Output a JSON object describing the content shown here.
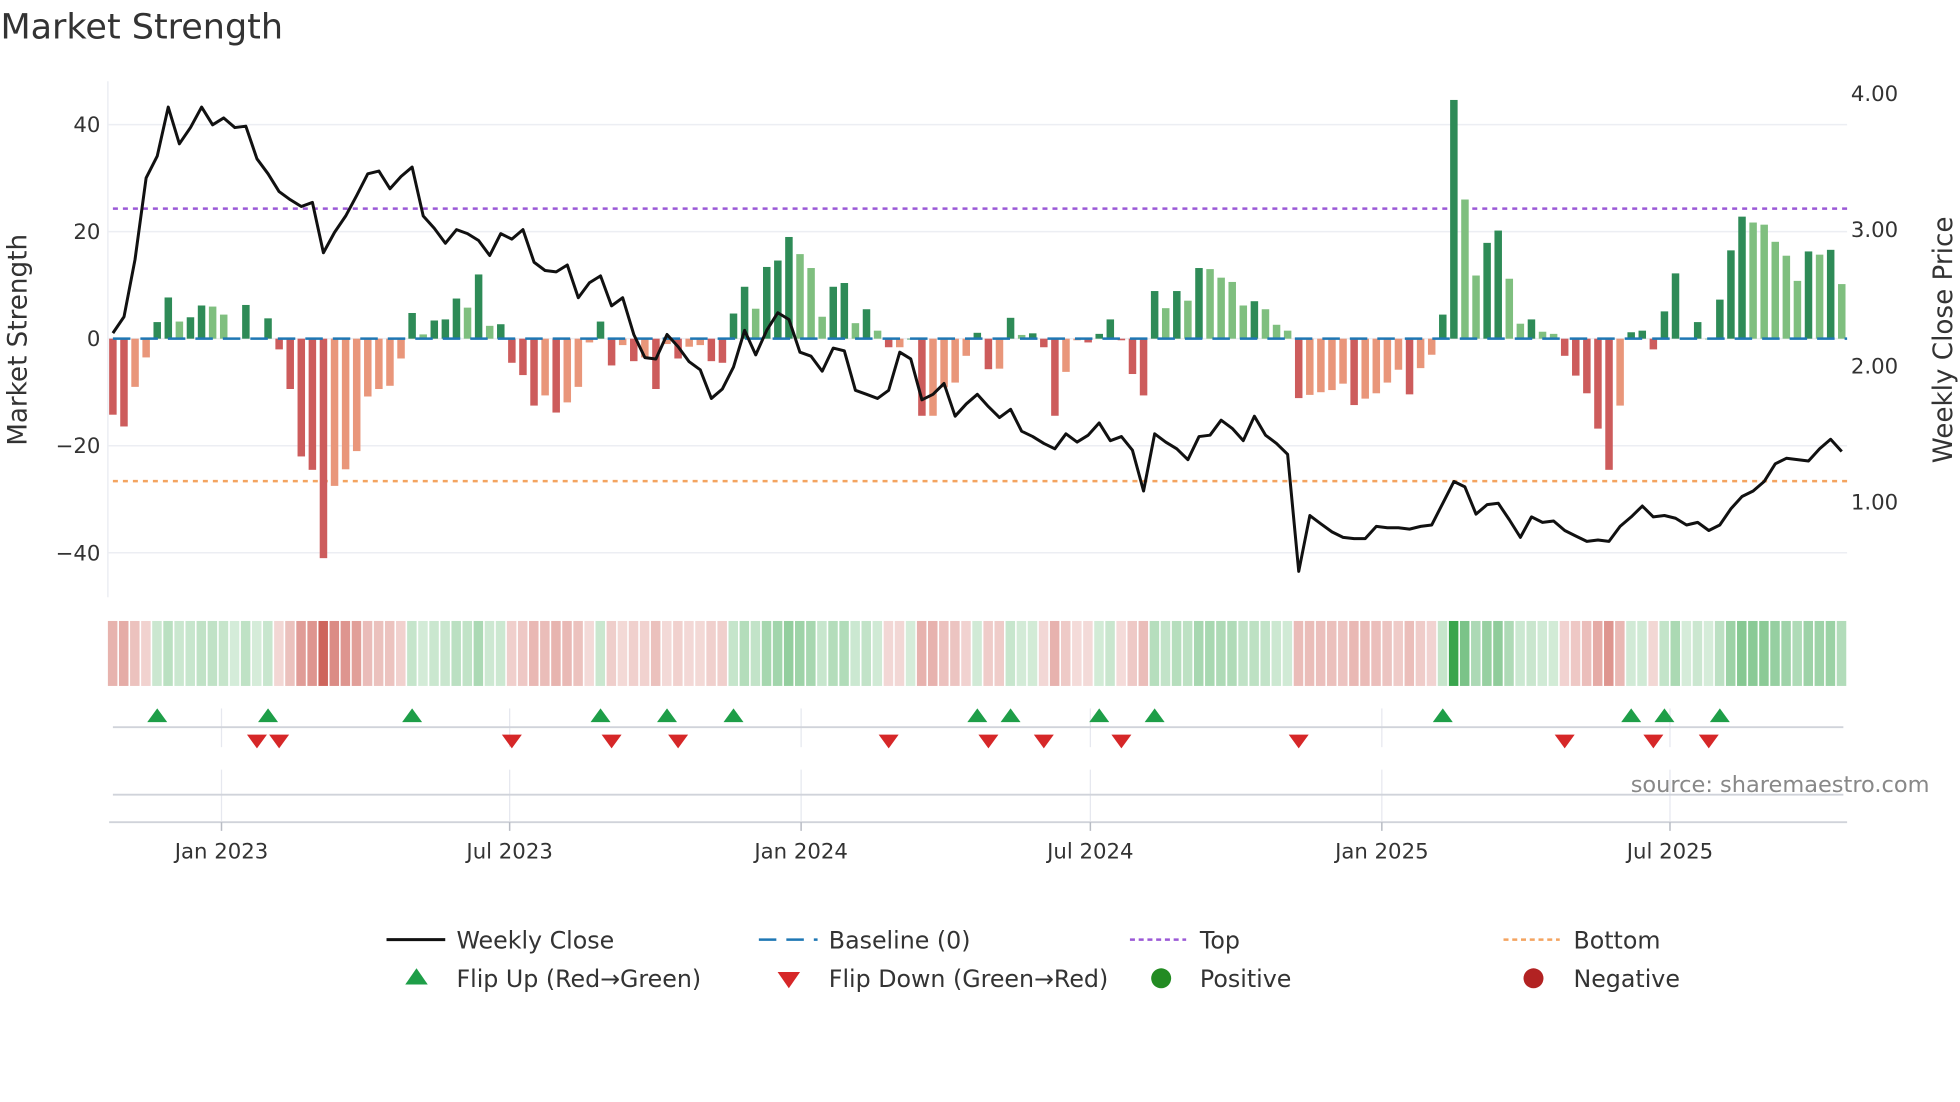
{
  "chart_data": {
    "type": "bar",
    "title": "Market Strength",
    "ylabel": "Market Strength",
    "y2label": "Weekly Close Price",
    "ylim": [
      -48.3,
      48.1
    ],
    "y2lim": [
      0.3,
      4.09
    ],
    "yticks": [
      {
        "v": 40,
        "label": "40"
      },
      {
        "v": 20,
        "label": "20"
      },
      {
        "v": 0,
        "label": "0"
      },
      {
        "v": -20,
        "label": "−20"
      },
      {
        "v": -40,
        "label": "−40"
      }
    ],
    "y2ticks": [
      {
        "v": 4,
        "label": "4.00"
      },
      {
        "v": 3,
        "label": "3.00"
      },
      {
        "v": 2,
        "label": "2.00"
      },
      {
        "v": 1,
        "label": "1.00"
      }
    ],
    "xticks": [
      {
        "week": 9.8,
        "label": "Jan 2023"
      },
      {
        "week": 35.8,
        "label": "Jul 2023"
      },
      {
        "week": 62.1,
        "label": "Jan 2024"
      },
      {
        "week": 88.2,
        "label": "Jul 2024"
      },
      {
        "week": 114.5,
        "label": "Jan 2025"
      },
      {
        "week": 140.5,
        "label": "Jul 2025"
      }
    ],
    "grid": true,
    "top_level": 24.3,
    "bottom_level": -26.6,
    "strength": [
      -14.2,
      -16.4,
      -9,
      -3.5,
      3.1,
      7.7,
      3.2,
      4,
      6.2,
      6,
      4.5,
      0.2,
      6.3,
      0,
      3.8,
      -2,
      -9.4,
      -22,
      -24.5,
      -41,
      -27.5,
      -24.4,
      -21,
      -10.8,
      -9.4,
      -8.8,
      -3.7,
      4.8,
      0.8,
      3.4,
      3.6,
      7.5,
      5.8,
      12,
      2.4,
      2.7,
      -4.5,
      -6.8,
      -12.5,
      -10.6,
      -13.8,
      -11.9,
      -9,
      -0.7,
      3.2,
      -5,
      -1.2,
      -4.2,
      -3.5,
      -9.4,
      -1,
      -3.7,
      -1.5,
      -1.2,
      -4.2,
      -4.5,
      4.7,
      9.7,
      5.6,
      13.4,
      14.6,
      19,
      15.8,
      13.2,
      4.1,
      9.7,
      10.4,
      2.9,
      5.5,
      1.5,
      -1.6,
      -1.6,
      0,
      -14.4,
      -14.4,
      -9.1,
      -8.2,
      -3.2,
      1.1,
      -5.7,
      -5.6,
      3.9,
      0.7,
      1,
      -1.6,
      -14.4,
      -6.2,
      -0.3,
      -0.7,
      0.9,
      3.6,
      -0.3,
      -6.6,
      -10.6,
      8.9,
      5.7,
      8.9,
      7.1,
      13.2,
      13,
      11.4,
      10.6,
      6.2,
      7,
      5.5,
      2.6,
      1.5,
      -11.1,
      -10.5,
      -10,
      -9.6,
      -8.4,
      -12.4,
      -11.2,
      -10.2,
      -8.2,
      -5.8,
      -10.4,
      -5.5,
      -3,
      4.5,
      44.6,
      26,
      11.8,
      17.9,
      20.2,
      11.2,
      2.8,
      3.6,
      1.3,
      0.9,
      -3.2,
      -6.9,
      -10.2,
      -16.8,
      -24.5,
      -12.5,
      1.2,
      1.5,
      -2,
      5.1,
      12.2,
      0,
      3.1,
      0,
      7.3,
      16.5,
      22.8,
      21.7,
      21.3,
      18.1,
      15.5,
      10.8,
      16.3,
      15.7,
      16.6,
      10.2
    ],
    "weekly_close": [
      2.24,
      2.36,
      2.78,
      3.38,
      3.54,
      3.9,
      3.63,
      3.75,
      3.9,
      3.77,
      3.82,
      3.75,
      3.76,
      3.52,
      3.41,
      3.28,
      3.22,
      3.17,
      3.2,
      2.83,
      2.98,
      3.1,
      3.25,
      3.41,
      3.43,
      3.3,
      3.39,
      3.46,
      3.1,
      3.01,
      2.9,
      3.0,
      2.97,
      2.92,
      2.81,
      2.97,
      2.93,
      3.0,
      2.76,
      2.7,
      2.69,
      2.74,
      2.5,
      2.61,
      2.66,
      2.44,
      2.5,
      2.23,
      2.06,
      2.05,
      2.23,
      2.14,
      2.03,
      1.97,
      1.76,
      1.83,
      1.99,
      2.26,
      2.08,
      2.26,
      2.39,
      2.34,
      2.1,
      2.07,
      1.96,
      2.13,
      2.11,
      1.82,
      1.79,
      1.76,
      1.82,
      2.1,
      2.05,
      1.75,
      1.79,
      1.87,
      1.63,
      1.72,
      1.79,
      1.7,
      1.62,
      1.68,
      1.52,
      1.48,
      1.43,
      1.39,
      1.5,
      1.44,
      1.49,
      1.58,
      1.45,
      1.48,
      1.38,
      1.08,
      1.5,
      1.44,
      1.39,
      1.31,
      1.48,
      1.49,
      1.6,
      1.54,
      1.45,
      1.63,
      1.49,
      1.43,
      1.35,
      0.49,
      0.9,
      0.84,
      0.78,
      0.74,
      0.73,
      0.73,
      0.82,
      0.81,
      0.81,
      0.8,
      0.82,
      0.83,
      0.99,
      1.15,
      1.11,
      0.91,
      0.98,
      0.99,
      0.87,
      0.74,
      0.89,
      0.85,
      0.86,
      0.79,
      0.75,
      0.71,
      0.72,
      0.71,
      0.82,
      0.89,
      0.97,
      0.89,
      0.9,
      0.88,
      0.83,
      0.85,
      0.79,
      0.83,
      0.95,
      1.04,
      1.08,
      1.15,
      1.28,
      1.32,
      1.31,
      1.3,
      1.39,
      1.46,
      1.37
    ],
    "flip_up_weeks": [
      4,
      14,
      27,
      44,
      50,
      56,
      78,
      81,
      89,
      94,
      120,
      137,
      140,
      145
    ],
    "flip_down_weeks": [
      13,
      15,
      36,
      45,
      51,
      70,
      79,
      84,
      91,
      107,
      131,
      139,
      144
    ],
    "legend": {
      "placement": "bottom",
      "items": [
        {
          "key": "close",
          "label": "Weekly Close"
        },
        {
          "key": "baseline",
          "label": "Baseline (0)"
        },
        {
          "key": "top",
          "label": "Top"
        },
        {
          "key": "bottom",
          "label": "Bottom"
        },
        {
          "key": "flipup",
          "label": "Flip Up (Red→Green)"
        },
        {
          "key": "flipdown",
          "label": "Flip Down (Green→Red)"
        },
        {
          "key": "positive",
          "label": "Positive"
        },
        {
          "key": "negative",
          "label": "Negative"
        }
      ]
    },
    "colors": {
      "green_up": "#2e8b57",
      "green_down": "#7fbf7f",
      "red_down": "#cd5c5c",
      "red_up": "#e9967a",
      "baseline": "#1f77b4",
      "top": "#9b59d6",
      "bottom": "#f4a460",
      "close": "#111111",
      "flip_up": "#1e9e48",
      "flip_down": "#d62728",
      "positive": "#228b22",
      "negative": "#b22222"
    },
    "source": "source: sharemaestro.com"
  }
}
